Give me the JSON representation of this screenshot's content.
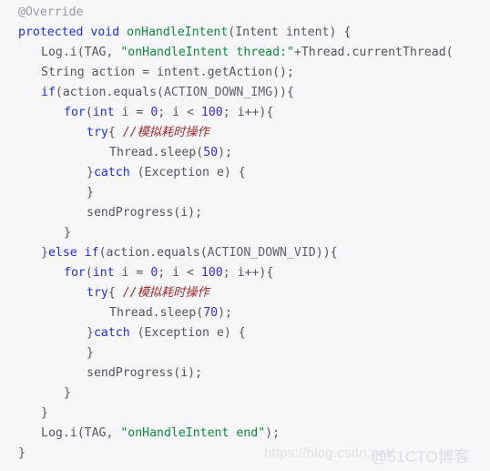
{
  "document": {
    "kind": "code-snippet",
    "language": "Java",
    "background_color": "#f7f7f9",
    "colors": {
      "keyword": "#1f31d4",
      "method": "#0f8a3f",
      "string": "#0f8a3f",
      "number": "#3a2fc8",
      "annotation": "#9a9aa5",
      "comment": "#9b2d2d",
      "plain": "#4a4a55",
      "watermark": "#e0e0e6"
    }
  },
  "code": {
    "lines": [
      {
        "indent": 1,
        "tokens": [
          {
            "t": "@Override",
            "c": "annot"
          }
        ]
      },
      {
        "indent": 1,
        "tokens": [
          {
            "t": "protected",
            "c": "keyword"
          },
          {
            "t": " ",
            "c": "plain"
          },
          {
            "t": "void",
            "c": "keyword"
          },
          {
            "t": " ",
            "c": "plain"
          },
          {
            "t": "onHandleIntent",
            "c": "method"
          },
          {
            "t": "(Intent intent) {",
            "c": "plain"
          }
        ]
      },
      {
        "indent": 2,
        "tokens": [
          {
            "t": "Log.i(TAG, ",
            "c": "plain"
          },
          {
            "t": "\"onHandleIntent thread:\"",
            "c": "string"
          },
          {
            "t": "+Thread.currentThread(",
            "c": "plain"
          }
        ]
      },
      {
        "indent": 2,
        "tokens": [
          {
            "t": "String action = intent.getAction();",
            "c": "plain"
          }
        ]
      },
      {
        "indent": 2,
        "tokens": [
          {
            "t": "if",
            "c": "keyword"
          },
          {
            "t": "(action.equals(",
            "c": "plain"
          },
          {
            "t": "ACTION_DOWN_IMG",
            "c": "const"
          },
          {
            "t": ")){",
            "c": "plain"
          }
        ]
      },
      {
        "indent": 3,
        "tokens": [
          {
            "t": "for",
            "c": "keyword"
          },
          {
            "t": "(",
            "c": "plain"
          },
          {
            "t": "int",
            "c": "keyword"
          },
          {
            "t": " i = ",
            "c": "plain"
          },
          {
            "t": "0",
            "c": "number"
          },
          {
            "t": "; i < ",
            "c": "plain"
          },
          {
            "t": "100",
            "c": "number"
          },
          {
            "t": "; i++){",
            "c": "plain"
          }
        ]
      },
      {
        "indent": 4,
        "tokens": [
          {
            "t": "try",
            "c": "keyword"
          },
          {
            "t": "{ ",
            "c": "plain"
          },
          {
            "t": "//模拟耗时操作",
            "c": "comment"
          }
        ]
      },
      {
        "indent": 5,
        "tokens": [
          {
            "t": "Thread.sleep(",
            "c": "plain"
          },
          {
            "t": "50",
            "c": "number"
          },
          {
            "t": ");",
            "c": "plain"
          }
        ]
      },
      {
        "indent": 4,
        "tokens": [
          {
            "t": "}",
            "c": "plain"
          },
          {
            "t": "catch",
            "c": "keyword"
          },
          {
            "t": " (Exception e) {",
            "c": "plain"
          }
        ]
      },
      {
        "indent": 4,
        "tokens": [
          {
            "t": "}",
            "c": "plain"
          }
        ]
      },
      {
        "indent": 4,
        "tokens": [
          {
            "t": "sendProgress(i);",
            "c": "plain"
          }
        ]
      },
      {
        "indent": 3,
        "tokens": [
          {
            "t": "}",
            "c": "plain"
          }
        ]
      },
      {
        "indent": 2,
        "tokens": [
          {
            "t": "}",
            "c": "plain"
          },
          {
            "t": "else",
            "c": "keyword"
          },
          {
            "t": " ",
            "c": "plain"
          },
          {
            "t": "if",
            "c": "keyword"
          },
          {
            "t": "(action.equals(",
            "c": "plain"
          },
          {
            "t": "ACTION_DOWN_VID",
            "c": "const"
          },
          {
            "t": ")){",
            "c": "plain"
          }
        ]
      },
      {
        "indent": 3,
        "tokens": [
          {
            "t": "for",
            "c": "keyword"
          },
          {
            "t": "(",
            "c": "plain"
          },
          {
            "t": "int",
            "c": "keyword"
          },
          {
            "t": " i = ",
            "c": "plain"
          },
          {
            "t": "0",
            "c": "number"
          },
          {
            "t": "; i < ",
            "c": "plain"
          },
          {
            "t": "100",
            "c": "number"
          },
          {
            "t": "; i++){",
            "c": "plain"
          }
        ]
      },
      {
        "indent": 4,
        "tokens": [
          {
            "t": "try",
            "c": "keyword"
          },
          {
            "t": "{ ",
            "c": "plain"
          },
          {
            "t": "//模拟耗时操作",
            "c": "comment"
          }
        ]
      },
      {
        "indent": 5,
        "tokens": [
          {
            "t": "Thread.sleep(",
            "c": "plain"
          },
          {
            "t": "70",
            "c": "number"
          },
          {
            "t": ");",
            "c": "plain"
          }
        ]
      },
      {
        "indent": 4,
        "tokens": [
          {
            "t": "}",
            "c": "plain"
          },
          {
            "t": "catch",
            "c": "keyword"
          },
          {
            "t": " (Exception e) {",
            "c": "plain"
          }
        ]
      },
      {
        "indent": 4,
        "tokens": [
          {
            "t": "}",
            "c": "plain"
          }
        ]
      },
      {
        "indent": 4,
        "tokens": [
          {
            "t": "sendProgress(i);",
            "c": "plain"
          }
        ]
      },
      {
        "indent": 3,
        "tokens": [
          {
            "t": "}",
            "c": "plain"
          }
        ]
      },
      {
        "indent": 2,
        "tokens": [
          {
            "t": "}",
            "c": "plain"
          }
        ]
      },
      {
        "indent": 2,
        "tokens": [
          {
            "t": "Log.i(TAG, ",
            "c": "plain"
          },
          {
            "t": "\"onHandleIntent end\"",
            "c": "string"
          },
          {
            "t": ");",
            "c": "plain"
          }
        ]
      },
      {
        "indent": 1,
        "tokens": [
          {
            "t": "}",
            "c": "plain"
          }
        ]
      }
    ]
  },
  "watermarks": {
    "url": "https://blog.csdn.net/",
    "site": "@51CTO博客"
  }
}
